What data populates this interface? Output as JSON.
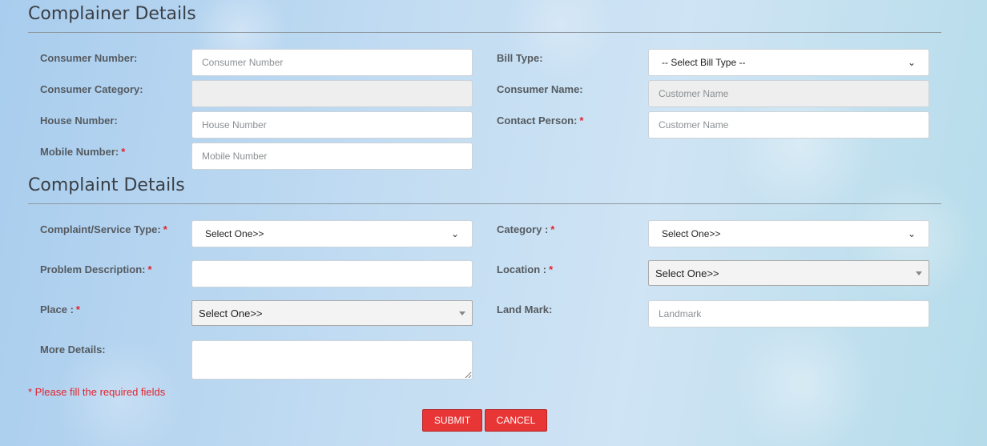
{
  "complainer": {
    "title": "Complainer Details",
    "consumer_number": {
      "label": "Consumer Number:",
      "placeholder": "Consumer Number"
    },
    "bill_type": {
      "label": "Bill Type:",
      "selected": "-- Select Bill Type --"
    },
    "consumer_category": {
      "label": "Consumer Category:"
    },
    "consumer_name": {
      "label": "Consumer Name:",
      "placeholder": "Customer Name"
    },
    "house_number": {
      "label": "House Number:",
      "placeholder": "House Number"
    },
    "contact_person": {
      "label": "Contact Person:",
      "placeholder": "Customer Name"
    },
    "mobile_number": {
      "label": "Mobile Number:",
      "placeholder": "Mobile Number"
    }
  },
  "complaint": {
    "title": "Complaint Details",
    "service_type": {
      "label": "Complaint/Service Type:",
      "selected": "Select One>>"
    },
    "category": {
      "label": "Category :",
      "selected": "Select One>>"
    },
    "problem_description": {
      "label": "Problem Description:"
    },
    "location": {
      "label": "Location :",
      "selected": "Select One>>"
    },
    "place": {
      "label": "Place :",
      "selected": "Select One>>"
    },
    "landmark": {
      "label": "Land Mark:",
      "placeholder": "Landmark"
    },
    "more_details": {
      "label": "More Details:"
    }
  },
  "required_marker": "*",
  "required_note": "* Please fill the required fields",
  "buttons": {
    "submit": "SUBMIT",
    "cancel": "CANCEL"
  },
  "colors": {
    "accent_red": "#e83535",
    "required_red": "#e3232d"
  }
}
